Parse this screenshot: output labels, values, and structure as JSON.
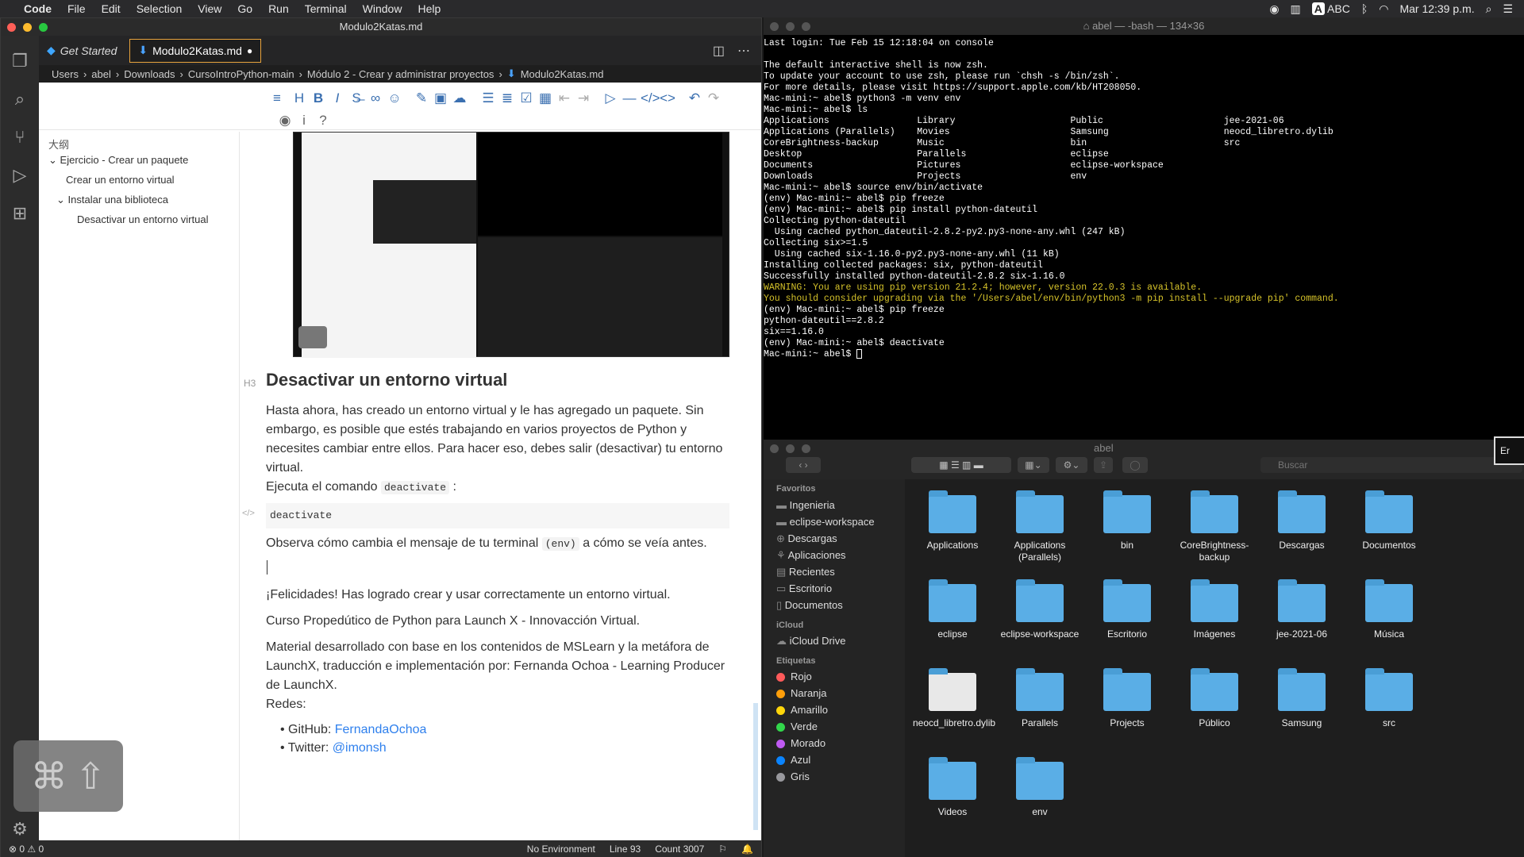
{
  "menubar": {
    "app": "Code",
    "items": [
      "File",
      "Edit",
      "Selection",
      "View",
      "Go",
      "Run",
      "Terminal",
      "Window",
      "Help"
    ],
    "input_source": "ABC",
    "clock": "Mar 12:39 p.m."
  },
  "vscode": {
    "window_title": "Modulo2Katas.md",
    "tabs": [
      {
        "label": "Get Started"
      },
      {
        "label": "Modulo2Katas.md"
      }
    ],
    "breadcrumb": [
      "Users",
      "abel",
      "Downloads",
      "CursoIntroPython-main",
      "Módulo 2 - Crear y administrar proyectos",
      "Modulo2Katas.md"
    ],
    "outline": {
      "title": "大纲",
      "items": [
        "Ejercicio - Crear un paquete",
        "Crear un entorno virtual",
        "Instalar una biblioteca",
        "Desactivar un entorno virtual"
      ]
    },
    "doc": {
      "heading_tag": "H3",
      "heading": "Desactivar un entorno virtual",
      "p1": "Hasta ahora, has creado un entorno virtual y le has agregado un paquete. Sin embargo, es posible que estés trabajando en varios proyectos de Python y necesites cambiar entre ellos. Para hacer eso, debes salir (desactivar) tu entorno virtual.",
      "p2_prefix": "Ejecuta el comando",
      "p2_code": "deactivate",
      "p2_suffix": ":",
      "codeblock_tag": "</>",
      "codeblock": "deactivate",
      "p3_prefix": "Observa cómo cambia el mensaje de tu terminal",
      "p3_code": "(env)",
      "p3_suffix": "a cómo se veía antes.",
      "p4": "¡Felicidades! Has logrado crear y usar correctamente un entorno virtual.",
      "p5": "Curso Propedútico de Python para Launch X - Innovacción Virtual.",
      "p6": "Material desarrollado con base en los contenidos de MSLearn y la metáfora de LaunchX, traducción e implementación por: Fernanda Ochoa - Learning Producer de LaunchX.",
      "p7": "Redes:",
      "li1_prefix": "GitHub:",
      "li1_link": "FernandaOchoa",
      "li2_prefix": "Twitter:",
      "li2_link": "@imonsh"
    },
    "status": {
      "problems": "⊗ 0  ⚠ 0",
      "env": "No Environment",
      "line": "Line 93",
      "count": "Count 3007"
    }
  },
  "terminal": {
    "title": "abel — -bash — 134×36",
    "lines": [
      {
        "t": "Last login: Tue Feb 15 12:18:04 on console",
        "c": "#fff"
      },
      {
        "t": "",
        "c": "#fff"
      },
      {
        "t": "The default interactive shell is now zsh.",
        "c": "#fff"
      },
      {
        "t": "To update your account to use zsh, please run `chsh -s /bin/zsh`.",
        "c": "#fff"
      },
      {
        "t": "For more details, please visit https://support.apple.com/kb/HT208050.",
        "c": "#fff"
      },
      {
        "t": "Mac-mini:~ abel$ python3 -m venv env",
        "c": "#fff"
      },
      {
        "t": "Mac-mini:~ abel$ ls",
        "c": "#fff"
      },
      {
        "t": "Applications                Library                     Public                      jee-2021-06",
        "c": "#fff"
      },
      {
        "t": "Applications (Parallels)    Movies                      Samsung                     neocd_libretro.dylib",
        "c": "#fff"
      },
      {
        "t": "CoreBrightness-backup       Music                       bin                         src",
        "c": "#fff"
      },
      {
        "t": "Desktop                     Parallels                   eclipse",
        "c": "#fff"
      },
      {
        "t": "Documents                   Pictures                    eclipse-workspace",
        "c": "#fff"
      },
      {
        "t": "Downloads                   Projects                    env",
        "c": "#fff"
      },
      {
        "t": "Mac-mini:~ abel$ source env/bin/activate",
        "c": "#fff"
      },
      {
        "t": "(env) Mac-mini:~ abel$ pip freeze",
        "c": "#fff"
      },
      {
        "t": "(env) Mac-mini:~ abel$ pip install python-dateutil",
        "c": "#fff"
      },
      {
        "t": "Collecting python-dateutil",
        "c": "#fff"
      },
      {
        "t": "  Using cached python_dateutil-2.8.2-py2.py3-none-any.whl (247 kB)",
        "c": "#fff"
      },
      {
        "t": "Collecting six>=1.5",
        "c": "#fff"
      },
      {
        "t": "  Using cached six-1.16.0-py2.py3-none-any.whl (11 kB)",
        "c": "#fff"
      },
      {
        "t": "Installing collected packages: six, python-dateutil",
        "c": "#fff"
      },
      {
        "t": "Successfully installed python-dateutil-2.8.2 six-1.16.0",
        "c": "#fff"
      },
      {
        "t": "WARNING: You are using pip version 21.2.4; however, version 22.0.3 is available.",
        "c": "#d6c32a"
      },
      {
        "t": "You should consider upgrading via the '/Users/abel/env/bin/python3 -m pip install --upgrade pip' command.",
        "c": "#d6c32a"
      },
      {
        "t": "(env) Mac-mini:~ abel$ pip freeze",
        "c": "#fff"
      },
      {
        "t": "python-dateutil==2.8.2",
        "c": "#fff"
      },
      {
        "t": "six==1.16.0",
        "c": "#fff"
      },
      {
        "t": "(env) Mac-mini:~ abel$ deactivate",
        "c": "#fff"
      },
      {
        "t": "Mac-mini:~ abel$ ",
        "c": "#fff"
      }
    ]
  },
  "finder": {
    "title": "abel",
    "search_placeholder": "Buscar",
    "sidebar": {
      "favorites_header": "Favoritos",
      "favorites": [
        "Ingenieria",
        "eclipse-workspace",
        "Descargas",
        "Aplicaciones",
        "Recientes",
        "Escritorio",
        "Documentos"
      ],
      "icloud_header": "iCloud",
      "icloud": [
        "iCloud Drive"
      ],
      "tags_header": "Etiquetas",
      "tags": [
        {
          "name": "Rojo",
          "color": "#ff5a5a"
        },
        {
          "name": "Naranja",
          "color": "#ff9f0a"
        },
        {
          "name": "Amarillo",
          "color": "#ffd60a"
        },
        {
          "name": "Verde",
          "color": "#32d74b"
        },
        {
          "name": "Morado",
          "color": "#bf5af2"
        },
        {
          "name": "Azul",
          "color": "#0a84ff"
        },
        {
          "name": "Gris",
          "color": "#98989d"
        }
      ]
    },
    "items": [
      "Applications",
      "Applications (Parallels)",
      "bin",
      "CoreBrightness-backup",
      "Descargas",
      "Documentos",
      "eclipse",
      "eclipse-workspace",
      "Escritorio",
      "Imágenes",
      "jee-2021-06",
      "Música",
      "neocd_libretro.dylib",
      "Parallels",
      "Projects",
      "Público",
      "Samsung",
      "src",
      "Videos",
      "env"
    ]
  },
  "overlay_hint": "Er"
}
